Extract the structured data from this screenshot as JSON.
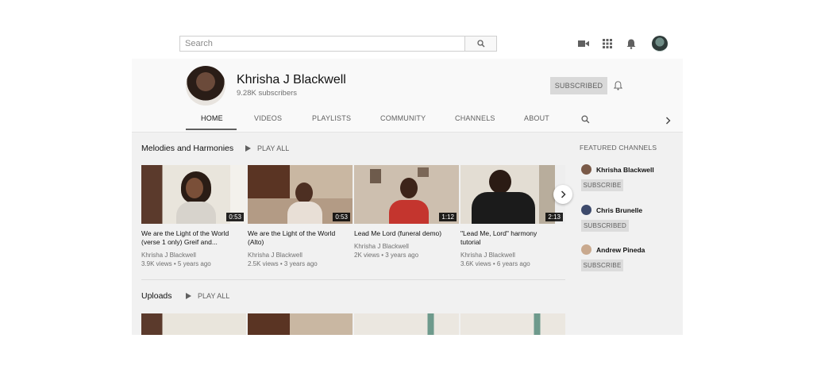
{
  "search": {
    "placeholder": "Search"
  },
  "topbar": {
    "icons": [
      "search-icon",
      "video-camera-icon",
      "apps-grid-icon",
      "notifications-bell-icon",
      "user-avatar"
    ]
  },
  "channel": {
    "name": "Khrisha J Blackwell",
    "subscribers": "9.28K subscribers",
    "subscribe_label": "SUBSCRIBED"
  },
  "tabs": [
    "HOME",
    "VIDEOS",
    "PLAYLISTS",
    "COMMUNITY",
    "CHANNELS",
    "ABOUT"
  ],
  "sections": [
    {
      "title": "Melodies and Harmonies",
      "play_all": "PLAY ALL",
      "videos": [
        {
          "title_line1": "We are the Light of the World",
          "title_line2": "(verse 1 only) Greif and...",
          "channel": "Khrisha J Blackwell",
          "meta": "3.9K views • 5 years ago",
          "duration": "0:53"
        },
        {
          "title_line1": "We are the Light of the World",
          "title_line2": "(Alto)",
          "channel": "Khrisha J Blackwell",
          "meta": "2.5K views • 3 years ago",
          "duration": "0:53"
        },
        {
          "title_line1": "Lead Me Lord (funeral demo)",
          "title_line2": "",
          "channel": "Khrisha J Blackwell",
          "meta": "2K views • 3 years ago",
          "duration": "1:12"
        },
        {
          "title_line1": "\"Lead Me, Lord\" harmony",
          "title_line2": "tutorial",
          "channel": "Khrisha J Blackwell",
          "meta": "3.6K views • 6 years ago",
          "duration": "2:13"
        }
      ]
    },
    {
      "title": "Uploads",
      "play_all": "PLAY ALL"
    }
  ],
  "featured": {
    "title": "FEATURED CHANNELS",
    "channels": [
      {
        "name": "Khrisha Blackwell",
        "button": "SUBSCRIBE",
        "color": "#7a5a48"
      },
      {
        "name": "Chris Brunelle",
        "button": "SUBSCRIBED",
        "color": "#3d4a6b"
      },
      {
        "name": "Andrew Pineda",
        "button": "SUBSCRIBE",
        "color": "#c9a98e"
      }
    ]
  },
  "colors": {
    "panel": "#f1f1f1",
    "header": "#f9f9f9",
    "button_grey": "#d9d9d9"
  }
}
